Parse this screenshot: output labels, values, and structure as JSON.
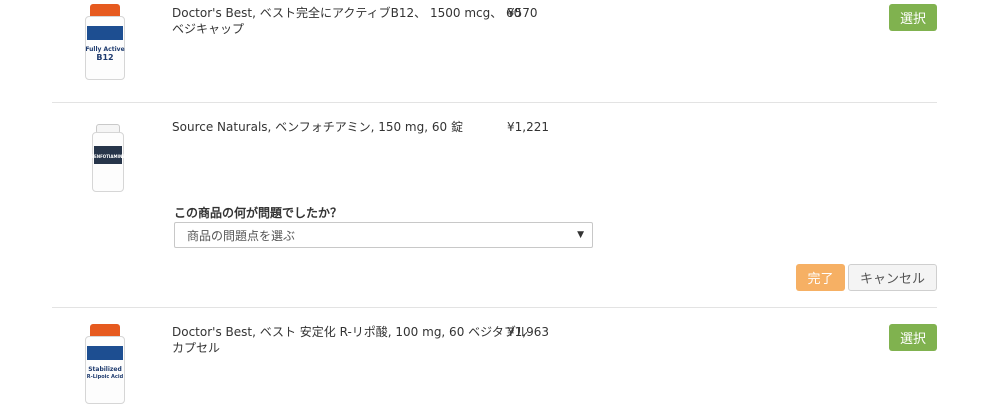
{
  "products": [
    {
      "name_line1": "Doctor's Best, ベスト完全にアクティブB12、 1500 mcg、 60",
      "name_line2": "ベジキャップ",
      "price": "¥570",
      "select_label": "選択",
      "label_line1": "Fully Active",
      "label_line2": "B12"
    },
    {
      "name_line1": "Source Naturals, ベンフォチアミン, 150 mg, 60 錠",
      "price": "¥1,221",
      "label_line1": "BENFOTIAMINE"
    },
    {
      "name_line1": "Doctor's Best, ベスト 安定化 R-リポ酸, 100 mg, 60 ベジタブル",
      "name_line2": "カプセル",
      "price": "¥1,963",
      "select_label": "選択",
      "label_line1": "Stabilized",
      "label_line2": "R-Lipoic Acid"
    }
  ],
  "feedback": {
    "question": "この商品の何が問題でしたか？",
    "select_value": "商品の問題点を選ぶ",
    "done_label": "完了",
    "cancel_label": "キャンセル"
  },
  "colors": {
    "select_button": "#80b24f",
    "done_button": "#f6b064",
    "separator": "#e3e3e3"
  }
}
